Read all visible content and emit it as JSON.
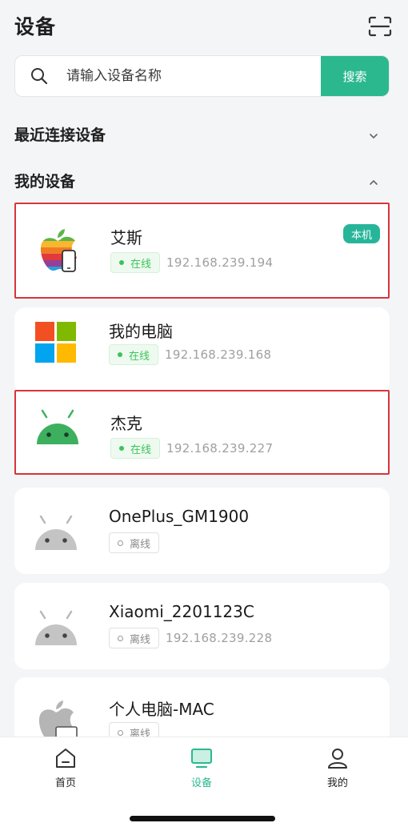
{
  "header": {
    "title": "设备"
  },
  "search": {
    "placeholder": "请输入设备名称",
    "button_label": "搜索"
  },
  "sections": {
    "recent": {
      "title": "最近连接设备"
    },
    "mine": {
      "title": "我的设备"
    }
  },
  "devices": [
    {
      "name": "艾斯",
      "status": "在线",
      "ip": "192.168.239.194",
      "badge": "本机",
      "icon": "apple-phone-icon",
      "highlighted": true
    },
    {
      "name": "我的电脑",
      "status": "在线",
      "ip": "192.168.239.168",
      "icon": "windows-icon",
      "highlighted": false
    },
    {
      "name": "杰克",
      "status": "在线",
      "ip": "192.168.239.227",
      "icon": "android-green-icon",
      "highlighted": true
    },
    {
      "name": "OnePlus_GM1900",
      "status": "离线",
      "ip": "",
      "icon": "android-gray-icon",
      "highlighted": false
    },
    {
      "name": "Xiaomi_2201123C",
      "status": "离线",
      "ip": "192.168.239.228",
      "icon": "android-gray-icon",
      "highlighted": false
    },
    {
      "name": "个人电脑-MAC",
      "status": "离线",
      "ip": "",
      "icon": "apple-mac-icon",
      "highlighted": false
    }
  ],
  "tabs": [
    {
      "label": "首页",
      "icon": "home-icon",
      "active": false
    },
    {
      "label": "设备",
      "icon": "monitor-icon",
      "active": true
    },
    {
      "label": "我的",
      "icon": "user-icon",
      "active": false
    }
  ],
  "colors": {
    "accent": "#2cb88f",
    "online": "#3cc35a",
    "highlight_border": "#d9343a"
  }
}
